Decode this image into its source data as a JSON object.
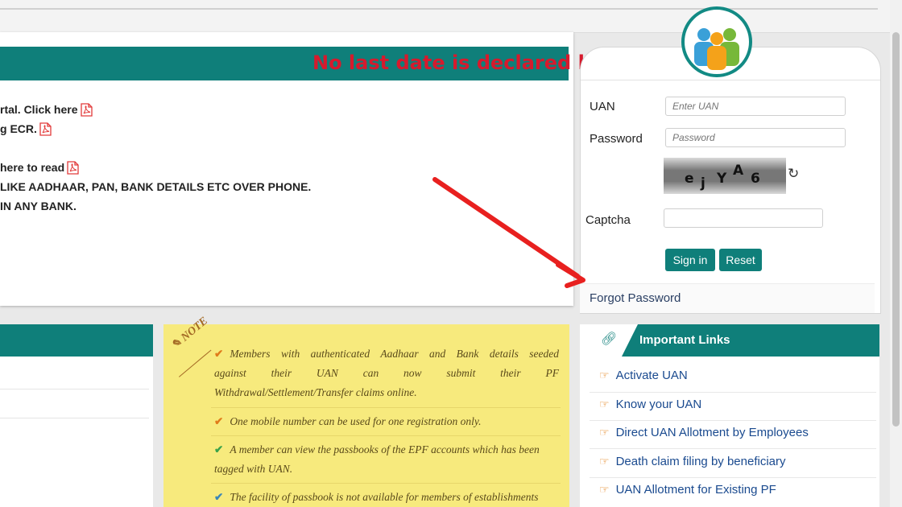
{
  "main": {
    "notice": "No last date is declared by",
    "lines": [
      {
        "text": "rtal. Click here",
        "pdf": true
      },
      {
        "text": "g ECR.",
        "pdf": true
      },
      {
        "text": "",
        "pdf": false
      },
      {
        "text": " here to read",
        "pdf": true
      },
      {
        "text": "LIKE AADHAAR, PAN, BANK DETAILS ETC OVER PHONE.",
        "pdf": false
      },
      {
        "text": " IN ANY BANK.",
        "pdf": false
      }
    ]
  },
  "login": {
    "uan_label": "UAN",
    "uan_placeholder": "Enter UAN",
    "password_label": "Password",
    "password_placeholder": "Password",
    "captcha_chars": [
      "e",
      "j",
      "Y",
      "A",
      "6"
    ],
    "captcha_label": "Captcha",
    "captcha_value": "",
    "signin_label": "Sign in",
    "reset_label": "Reset",
    "forgot_label": "Forgot Password"
  },
  "note": {
    "tag": "NOTE",
    "items": [
      {
        "check_color": "#e07b1a",
        "line1": "Members with authenticated Aadhaar and Bank details seeded",
        "line2": "against their UAN can now submit their PF",
        "line3": "Withdrawal/Settlement/Transfer claims online."
      },
      {
        "check_color": "#e07b1a",
        "line1": "One mobile number can be used for one registration only.",
        "line2": "",
        "line3": ""
      },
      {
        "check_color": "#3aa24a",
        "line1": "A member can view the passbooks of the EPF accounts which has been",
        "line2": "tagged with UAN.",
        "line3": ""
      },
      {
        "check_color": "#3a86b8",
        "line1": "The facility of passbook is not available for members of establishments",
        "line2": "",
        "line3": ""
      }
    ]
  },
  "links": {
    "title": "Important Links",
    "items": [
      "Activate UAN",
      "Know your UAN",
      "Direct UAN Allotment by Employees",
      "Death claim filing by beneficiary",
      "UAN Allotment for Existing PF"
    ]
  },
  "colors": {
    "teal": "#0f7f7a",
    "notice_red": "#d61a2d",
    "arrow_red": "#e8201f",
    "note_yellow": "#f7ea7d"
  }
}
